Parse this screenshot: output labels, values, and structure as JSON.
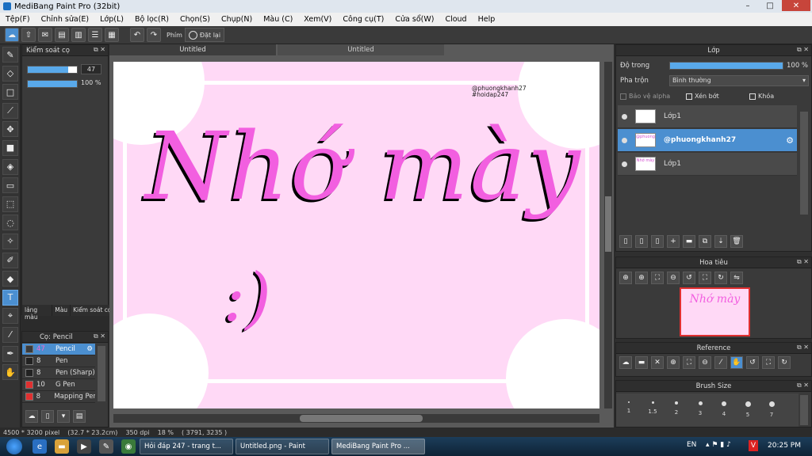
{
  "window": {
    "title": "MediBang Paint Pro (32bit)"
  },
  "menu": [
    "Tệp(F)",
    "Chỉnh sửa(E)",
    "Lớp(L)",
    "Bộ lọc(R)",
    "Chọn(S)",
    "Chụp(N)",
    "Màu (C)",
    "Xem(V)",
    "Công cụ(T)",
    "Cửa sổ(W)",
    "Cloud",
    "Help"
  ],
  "toolbar": {
    "key_label": "Phím",
    "reset_label": "Đặt lại"
  },
  "brush_control": {
    "title": "Kiểm soát cọ",
    "size_value": "47",
    "opacity_value": "100 %",
    "size_fraction": 0.82,
    "opacity_fraction": 1.0
  },
  "left_tabs": [
    "lảng màu",
    "Màu",
    "Kiểm soát cọ"
  ],
  "brush_panel": {
    "title": "Cọ: Pencil",
    "items": [
      {
        "size": "47",
        "name": "Pencil",
        "color": "#3a3a3a",
        "selected": true
      },
      {
        "size": "8",
        "name": "Pen",
        "color": "#222222",
        "selected": false
      },
      {
        "size": "8",
        "name": "Pen (Sharp)",
        "color": "#222222",
        "selected": false
      },
      {
        "size": "10",
        "name": "G Pen",
        "color": "#e03030",
        "selected": false
      },
      {
        "size": "8",
        "name": "Mapping Pen",
        "color": "#e03030",
        "selected": false
      }
    ]
  },
  "tabs": [
    {
      "label": "Untitled",
      "active": true
    },
    {
      "label": "Untitled",
      "active": false
    }
  ],
  "artwork": {
    "main_text": "Nhớ mày",
    "emoticon": ":)",
    "credit_line1": "@phuongkhanh27",
    "credit_line2": "#hoidap247"
  },
  "layer_panel": {
    "title": "Lớp",
    "opacity_label": "Độ trong",
    "opacity_value": "100 %",
    "opacity_fraction": 1.0,
    "blend_label": "Pha trộn",
    "blend_value": "Bình thường",
    "protect_alpha": "Bảo vệ alpha",
    "clipping": "Xén bớt",
    "lock": "Khóa",
    "layers": [
      {
        "name": "Lớp1",
        "selected": false,
        "thumb": ""
      },
      {
        "name": "@phuongkhanh27",
        "selected": true,
        "thumb": "@phuong"
      },
      {
        "name": "Lớp1",
        "selected": false,
        "thumb": "Nhớ mày"
      }
    ]
  },
  "navigator": {
    "title": "Hoa tiêu",
    "thumb_text": "Nhớ mày"
  },
  "reference": {
    "title": "Reference"
  },
  "brush_size": {
    "title": "Brush Size",
    "sizes": [
      "1",
      "1.5",
      "2",
      "3",
      "4",
      "5",
      "7"
    ]
  },
  "status": {
    "dimensions": "4500 * 3200 pixel",
    "cm": "(32.7 * 23.2cm)",
    "dpi": "350 dpi",
    "zoom": "18 %",
    "coords": "( 3791, 3235 )"
  },
  "taskbar": {
    "tasks": [
      "Hỏi đáp 247 - trang t...",
      "Untitled.png - Paint",
      "MediBang Paint Pro ..."
    ],
    "language": "EN",
    "clock": "20:25 PM"
  },
  "colors": {
    "accent": "#4b8fd0",
    "canvas_bg": "#ffd9f6",
    "text_pink": "#f25fe0"
  }
}
